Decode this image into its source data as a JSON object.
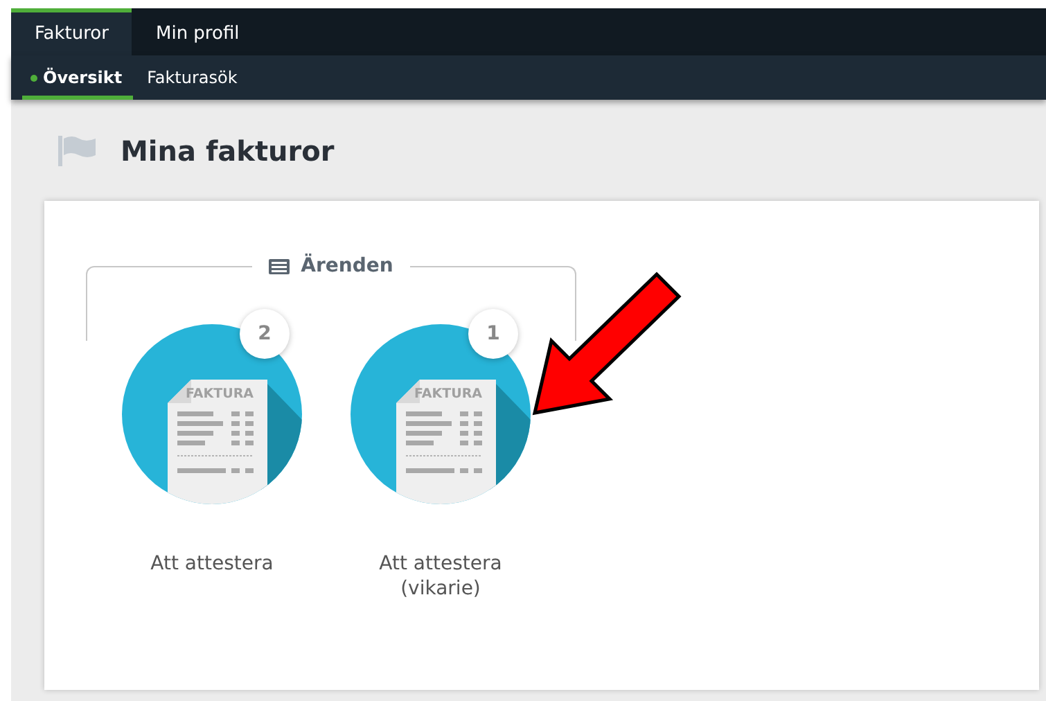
{
  "nav": {
    "tabs": [
      {
        "label": "Fakturor",
        "selected": true
      },
      {
        "label": "Min profil",
        "selected": false
      }
    ],
    "subtabs": [
      {
        "label": "Översikt",
        "selected": true
      },
      {
        "label": "Fakturasök",
        "selected": false
      }
    ]
  },
  "page": {
    "title": "Mina fakturor"
  },
  "group": {
    "title": "Ärenden",
    "tiles": [
      {
        "label": "Att attestera",
        "count": "2",
        "icon_text": "FAKTURA"
      },
      {
        "label": "Att attestera (vikarie)",
        "count": "1",
        "icon_text": "FAKTURA"
      }
    ]
  },
  "annotation": {
    "kind": "arrow"
  }
}
